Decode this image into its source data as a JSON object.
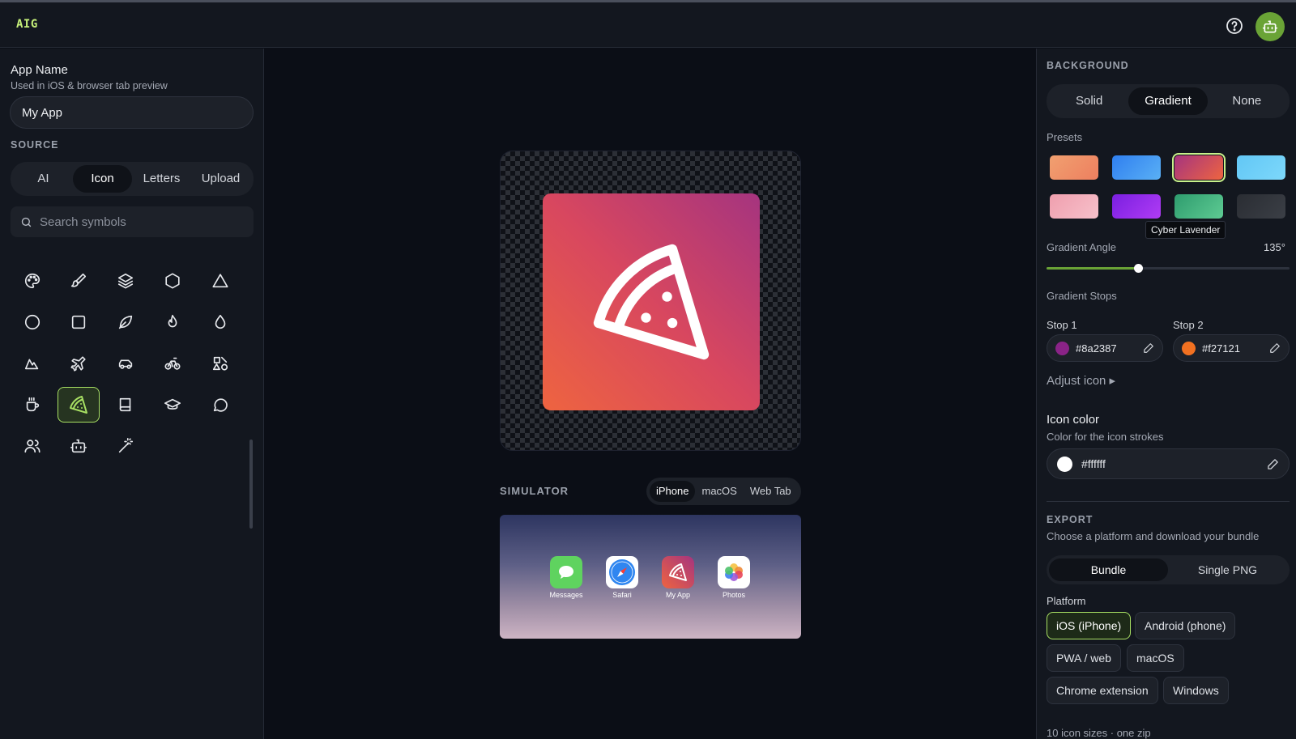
{
  "app": {
    "logo": "AIG"
  },
  "left": {
    "app_name_title": "App Name",
    "app_name_sub": "Used in iOS & browser tab preview",
    "app_name_value": "My App",
    "source_label": "SOURCE",
    "source_tabs": [
      "AI",
      "Icon",
      "Letters",
      "Upload"
    ],
    "source_active": "Icon",
    "search_placeholder": "Search symbols",
    "icons": [
      "palette",
      "brush",
      "layers",
      "hexagon",
      "triangle",
      "circle",
      "square",
      "leaf",
      "flame",
      "droplet",
      "mountain",
      "plane",
      "car",
      "bike",
      "shapes",
      "coffee",
      "pizza",
      "book",
      "graduation-cap",
      "message-circle",
      "users",
      "bot",
      "wand"
    ],
    "selected_icon": "pizza"
  },
  "center": {
    "simulator_label": "SIMULATOR",
    "sim_tabs": [
      "iPhone",
      "macOS",
      "Web Tab"
    ],
    "sim_active": "iPhone",
    "dock_apps": [
      "Messages",
      "Safari",
      "My App",
      "Photos"
    ]
  },
  "right": {
    "background_label": "BACKGROUND",
    "bg_tabs": [
      "Solid",
      "Gradient",
      "None"
    ],
    "bg_active": "Gradient",
    "presets_label": "Presets",
    "presets": [
      {
        "from": "#f0a070",
        "to": "#ee7f5f"
      },
      {
        "from": "#2f7ff0",
        "to": "#5ab0f5"
      },
      {
        "from": "#a5347f",
        "to": "#ee6440"
      },
      {
        "from": "#62c7f5",
        "to": "#7dd8fb"
      },
      {
        "from": "#ef9fae",
        "to": "#f7c1cb"
      },
      {
        "from": "#7a1fe0",
        "to": "#b03cf5"
      },
      {
        "from": "#2e9c6e",
        "to": "#5ecb93"
      },
      {
        "from": "#2a2d33",
        "to": "#3b3f46"
      }
    ],
    "selected_preset": 2,
    "tooltip": "Cyber Lavender",
    "angle_label": "Gradient Angle",
    "angle_value": "135°",
    "angle_fraction": 0.375,
    "stops_label": "Gradient Stops",
    "stop1_label": "Stop 1",
    "stop1_value": "#8a2387",
    "stop2_label": "Stop 2",
    "stop2_value": "#f27121",
    "adjust_icon": "Adjust icon ▸",
    "icon_color_title": "Icon color",
    "icon_color_sub": "Color for the icon strokes",
    "icon_color_value": "#ffffff",
    "export_label": "EXPORT",
    "export_sub": "Choose a platform and download your bundle",
    "export_tabs": [
      "Bundle",
      "Single PNG"
    ],
    "export_active": "Bundle",
    "platform_label": "Platform",
    "platforms": [
      "iOS (iPhone)",
      "Android (phone)",
      "PWA / web",
      "macOS",
      "Chrome extension",
      "Windows"
    ],
    "platform_active": "iOS (iPhone)",
    "footer": "10 icon sizes · one zip"
  },
  "colors": {
    "accent": "#a8e063",
    "panel": "#13171f",
    "bg": "#0b0e16"
  }
}
